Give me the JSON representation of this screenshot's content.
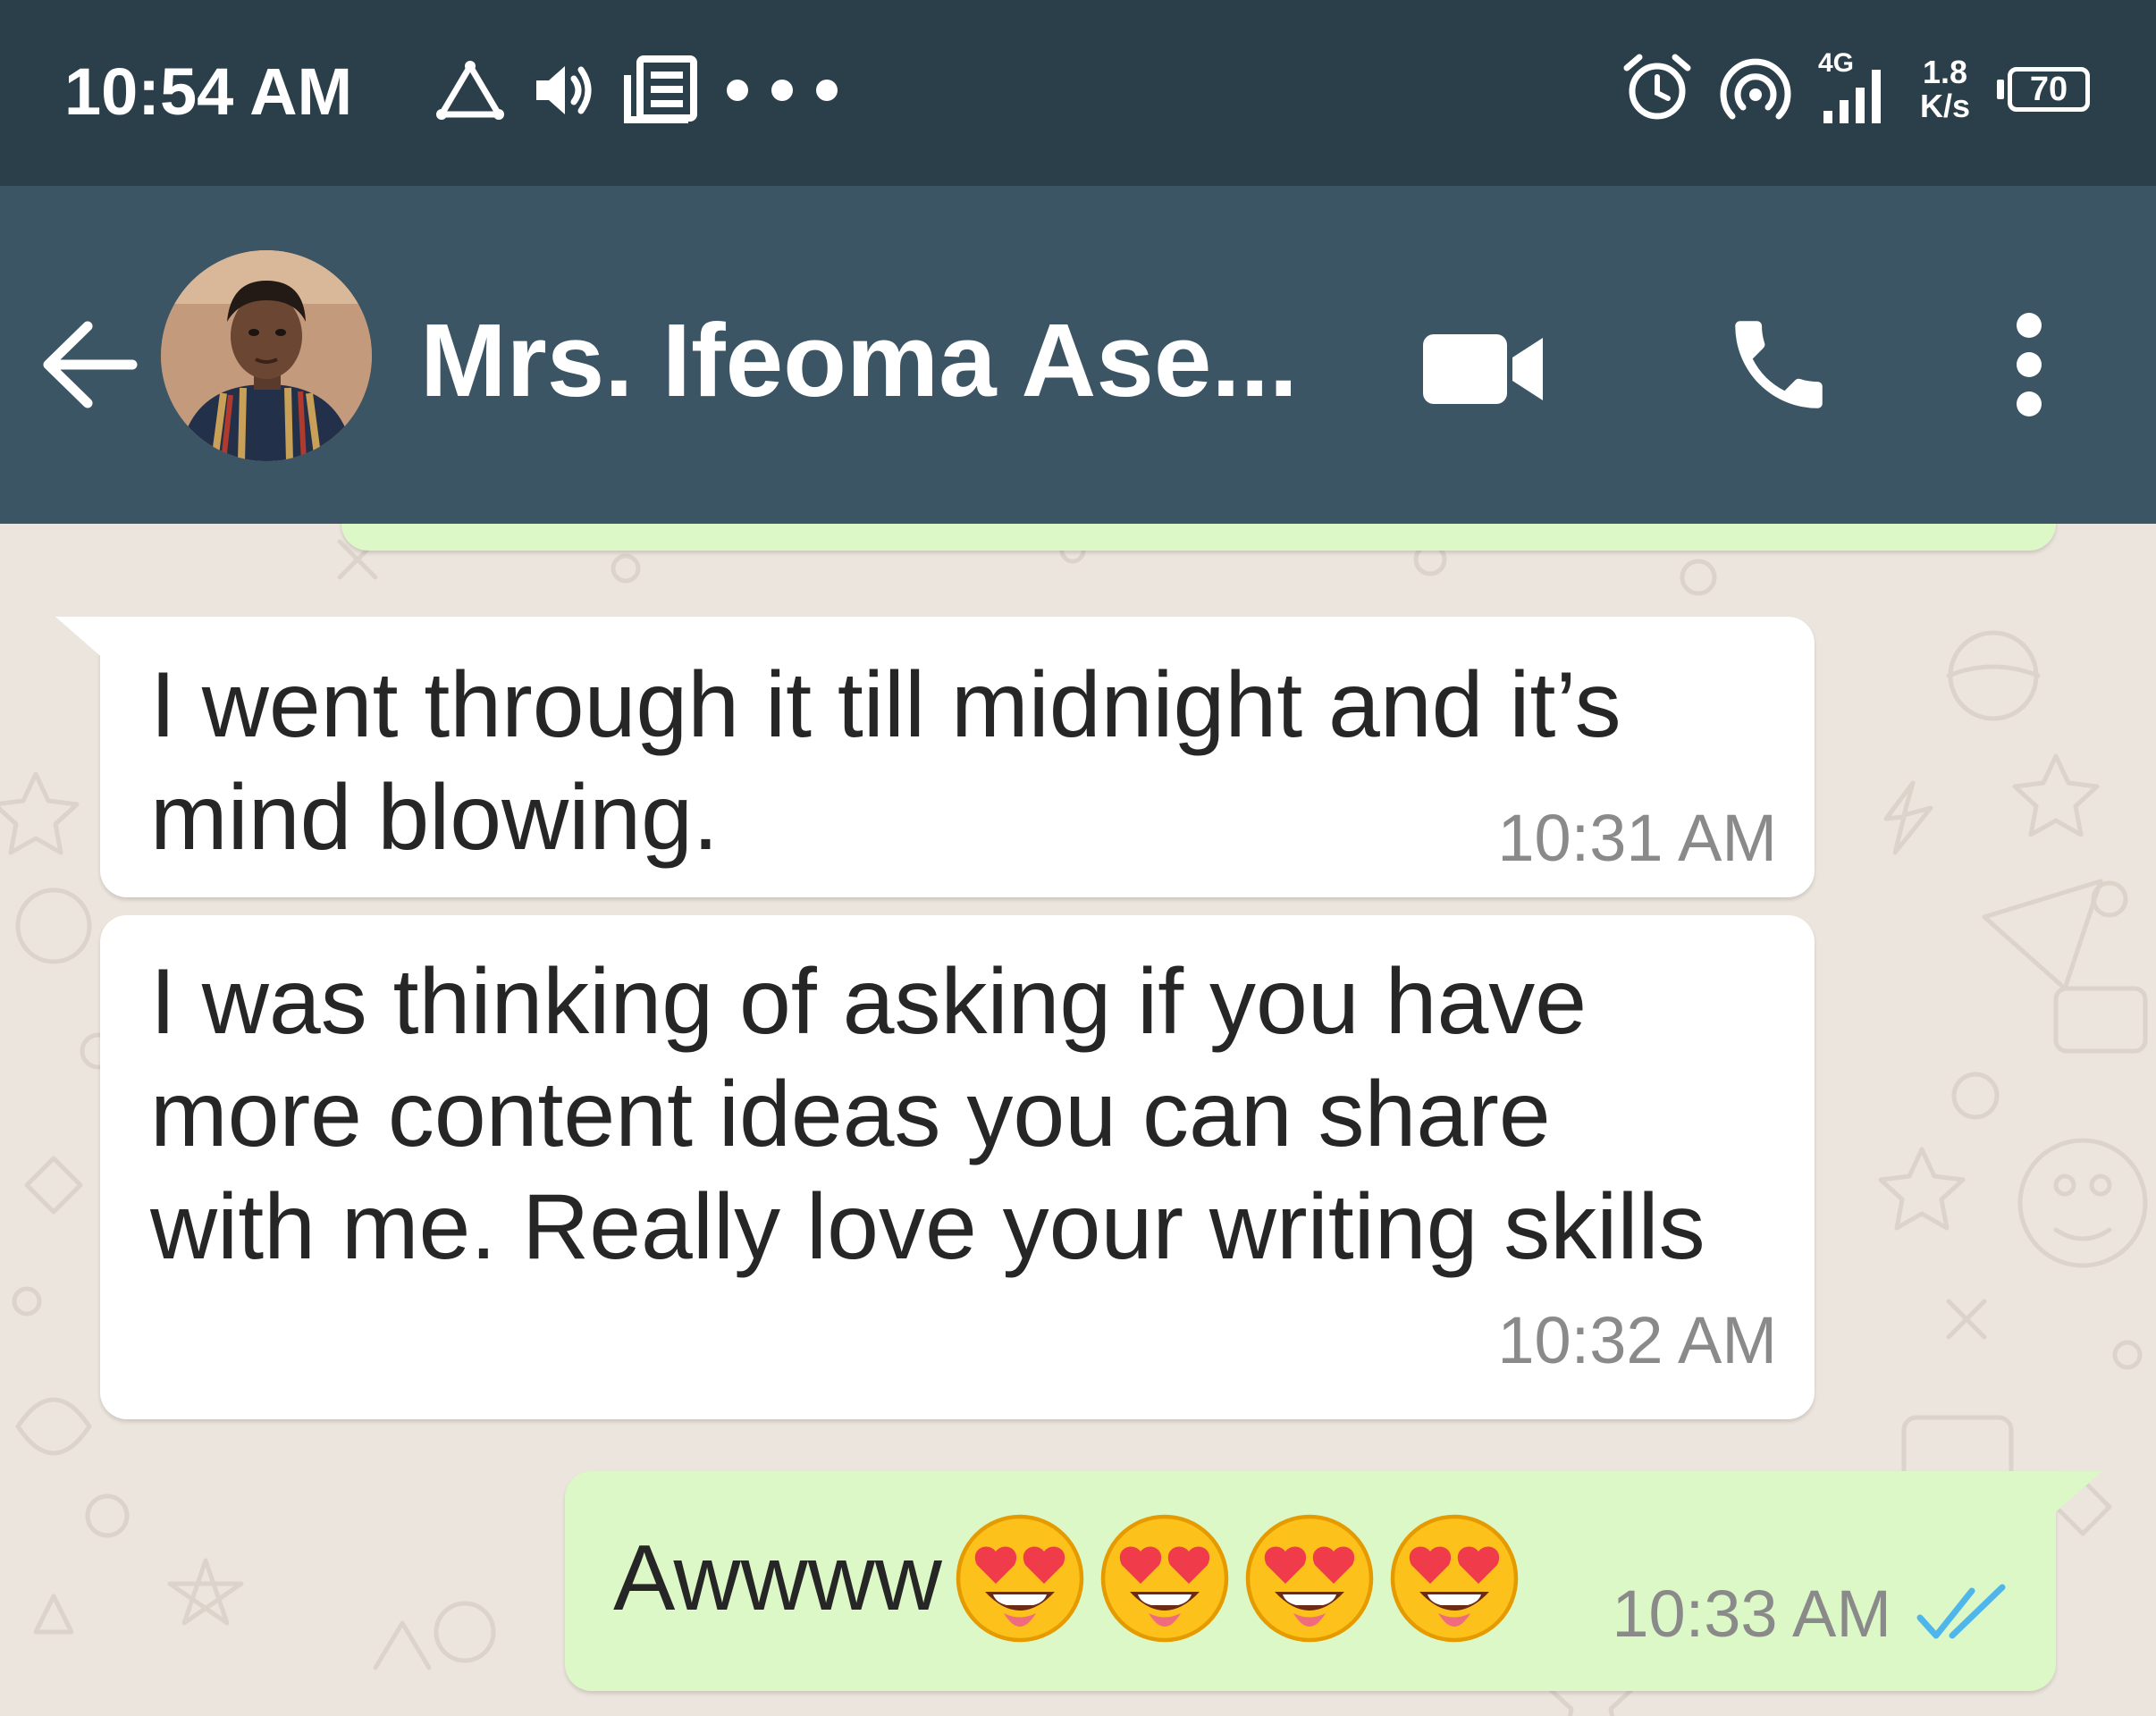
{
  "status_bar": {
    "time": "10:54 AM",
    "network": "4G",
    "net_speed_value": "1.8",
    "net_speed_unit": "K/s",
    "battery": "70"
  },
  "header": {
    "contact_name": "Mrs. Ifeoma Ase...",
    "icons": [
      "back-arrow-icon",
      "video-call-icon",
      "phone-icon",
      "more-vert-icon"
    ]
  },
  "messages": [
    {
      "direction": "incoming",
      "lines": [
        "I went through it till midnight and it’s",
        "mind blowing."
      ],
      "time": "10:31 AM"
    },
    {
      "direction": "incoming",
      "lines": [
        "I was thinking of asking if you have",
        "more content ideas you can share",
        "with me. Really love your writing skills"
      ],
      "time": "10:32 AM"
    },
    {
      "direction": "outgoing",
      "text": "Awwww",
      "emoji": "heart-eyes-emoji",
      "emoji_count": 4,
      "time": "10:33 AM",
      "status": "read"
    }
  ],
  "colors": {
    "status_bar_bg": "#2b3f4b",
    "header_bg": "#3b5565",
    "chat_bg": "#ece5dd",
    "incoming_bubble": "#ffffff",
    "outgoing_bubble": "#dcf8c6",
    "read_ticks": "#4fb6ec"
  }
}
